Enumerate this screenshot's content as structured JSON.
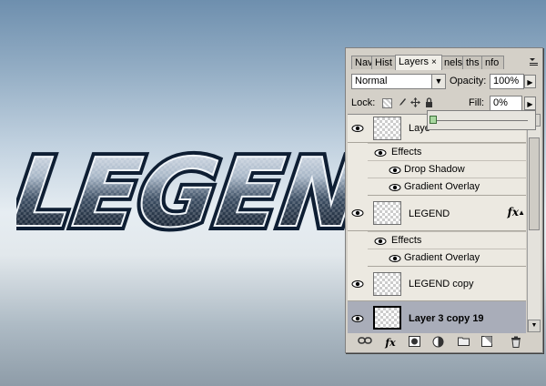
{
  "canvas": {
    "art_text": "LEGEND",
    "bg_top": "#6e8fae",
    "bg_mid": "#e6edf2",
    "bg_bottom": "#8e9ca8"
  },
  "panel": {
    "tabs": [
      {
        "label": "Nav",
        "icon": "none"
      },
      {
        "label": "Hist",
        "icon": "none"
      },
      {
        "label": "Layers",
        "icon": "close-icon",
        "active": true
      },
      {
        "label": "nels",
        "icon": "none"
      },
      {
        "label": "ths",
        "icon": "none"
      },
      {
        "label": "nfo",
        "icon": "none"
      }
    ],
    "close_glyph": "×",
    "blend_mode": "Normal",
    "opacity_label": "Opacity:",
    "opacity_value": "100%",
    "lock_label": "Lock:",
    "fill_label": "Fill:",
    "fill_value": "0%",
    "fill_slider_value": 0
  },
  "layers": [
    {
      "name": "Laye",
      "fx": false,
      "visible": true,
      "selected": false,
      "effects_label": "Effects",
      "effects": [
        "Drop Shadow",
        "Gradient Overlay"
      ]
    },
    {
      "name": "LEGEND",
      "fx": true,
      "fx_label": "fx",
      "visible": true,
      "selected": false,
      "effects_label": "Effects",
      "effects": [
        "Gradient Overlay"
      ]
    },
    {
      "name": "LEGEND copy",
      "visible": true,
      "selected": false
    },
    {
      "name": "Layer 3 copy 19",
      "visible": true,
      "selected": true
    }
  ],
  "bottom_icons": [
    "link-icon",
    "fx-icon",
    "mask-icon",
    "adjustment-icon",
    "folder-icon",
    "new-layer-icon",
    "trash-icon"
  ],
  "bottom_fx_label": "fx"
}
